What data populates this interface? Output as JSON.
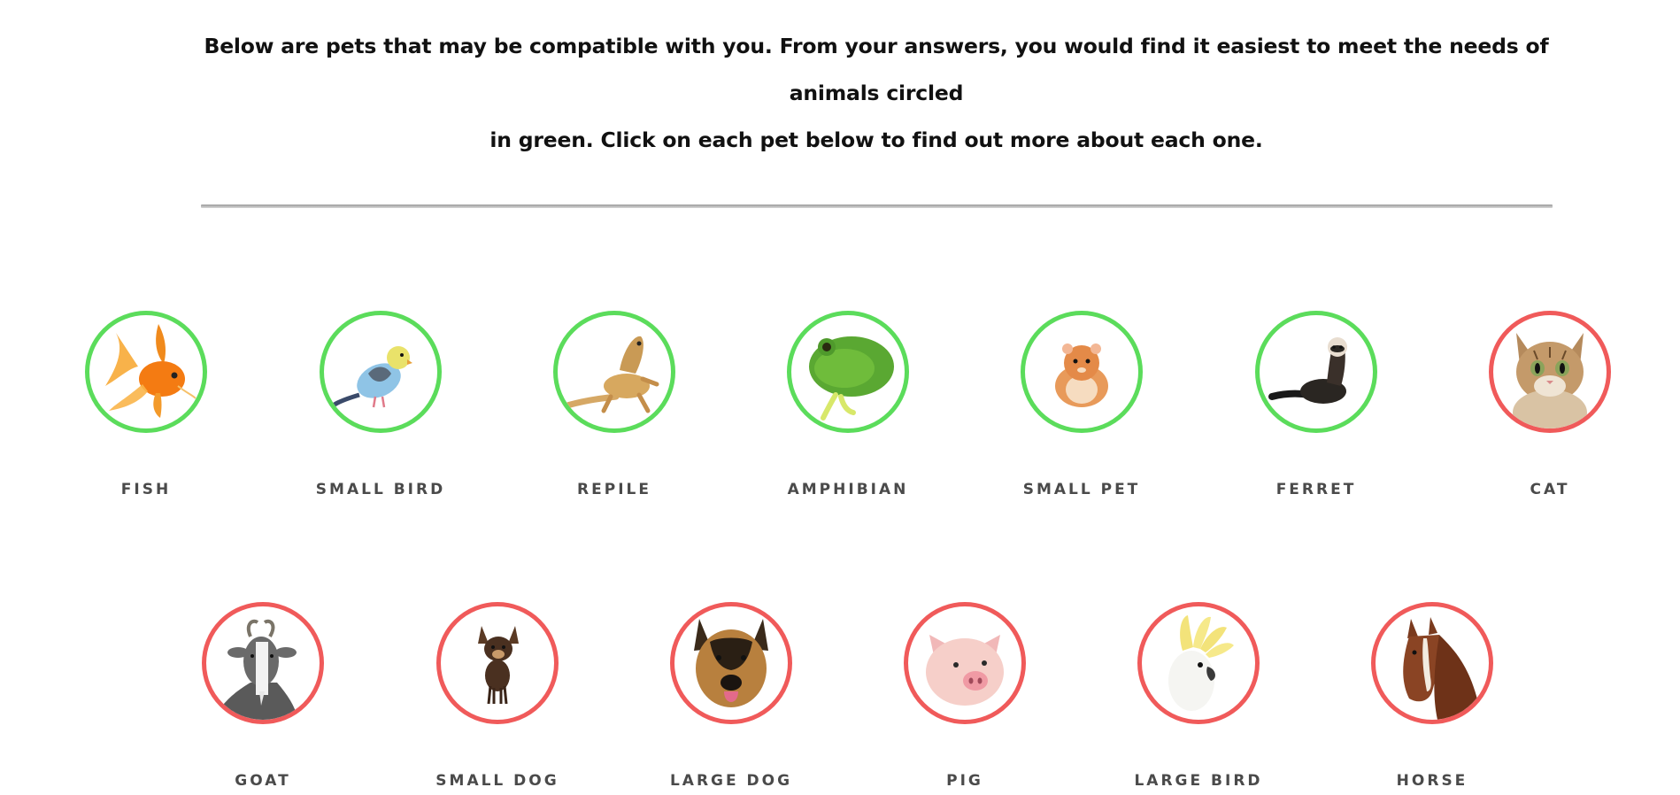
{
  "intro": {
    "line1": "Below are pets that may be compatible with you. From your answers, you would find it easiest to meet the needs of animals circled",
    "line2": "in green. Click on each pet below to find out more about each one."
  },
  "colors": {
    "compatible": "#5bdc5b",
    "incompatible": "#f05a5a"
  },
  "pets_row1": [
    {
      "label": "FISH",
      "status": "compatible",
      "icon": "goldfish-icon"
    },
    {
      "label": "SMALL BIRD",
      "status": "compatible",
      "icon": "budgie-icon"
    },
    {
      "label": "REPILE",
      "status": "compatible",
      "icon": "bearded-dragon-icon"
    },
    {
      "label": "AMPHIBIAN",
      "status": "compatible",
      "icon": "frog-icon"
    },
    {
      "label": "SMALL PET",
      "status": "compatible",
      "icon": "hamster-icon"
    },
    {
      "label": "FERRET",
      "status": "compatible",
      "icon": "ferret-icon"
    },
    {
      "label": "CAT",
      "status": "incompatible",
      "icon": "kitten-icon"
    }
  ],
  "pets_row2": [
    {
      "label": "GOAT",
      "status": "incompatible",
      "icon": "goat-icon"
    },
    {
      "label": "SMALL DOG",
      "status": "incompatible",
      "icon": "chihuahua-icon"
    },
    {
      "label": "LARGE DOG",
      "status": "incompatible",
      "icon": "german-shepherd-icon"
    },
    {
      "label": "PIG",
      "status": "incompatible",
      "icon": "piglet-icon"
    },
    {
      "label": "LARGE BIRD",
      "status": "incompatible",
      "icon": "cockatoo-icon"
    },
    {
      "label": "HORSE",
      "status": "incompatible",
      "icon": "horse-icon"
    }
  ]
}
